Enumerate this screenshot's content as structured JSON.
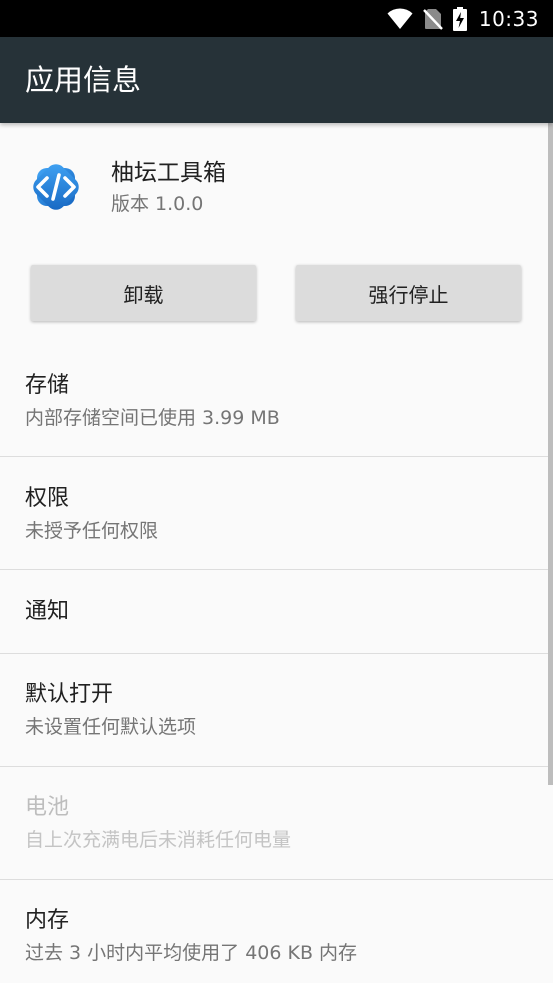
{
  "status_bar": {
    "time": "10:33",
    "icons": [
      "wifi-icon",
      "no-sim-icon",
      "battery-charging-icon"
    ]
  },
  "app_bar": {
    "title": "应用信息"
  },
  "app": {
    "name": "柚坛工具箱",
    "version": "版本 1.0.0",
    "icon": "code-brackets-icon",
    "icon_color": "#1e88e5"
  },
  "buttons": {
    "uninstall": "卸载",
    "force_stop": "强行停止"
  },
  "settings": {
    "storage": {
      "title": "存储",
      "summary": "内部存储空间已使用 3.99 MB"
    },
    "permissions": {
      "title": "权限",
      "summary": "未授予任何权限"
    },
    "notifications": {
      "title": "通知"
    },
    "open_by_default": {
      "title": "默认打开",
      "summary": "未设置任何默认选项"
    },
    "battery": {
      "title": "电池",
      "summary": "自上次充满电后未消耗任何电量"
    },
    "memory": {
      "title": "内存",
      "summary": "过去 3 小时内平均使用了 406 KB 内存"
    }
  },
  "colors": {
    "status_bar": "#000000",
    "app_bar": "#263238",
    "background": "#fafafa",
    "button": "#dcdcdc",
    "divider": "#dddddd"
  }
}
